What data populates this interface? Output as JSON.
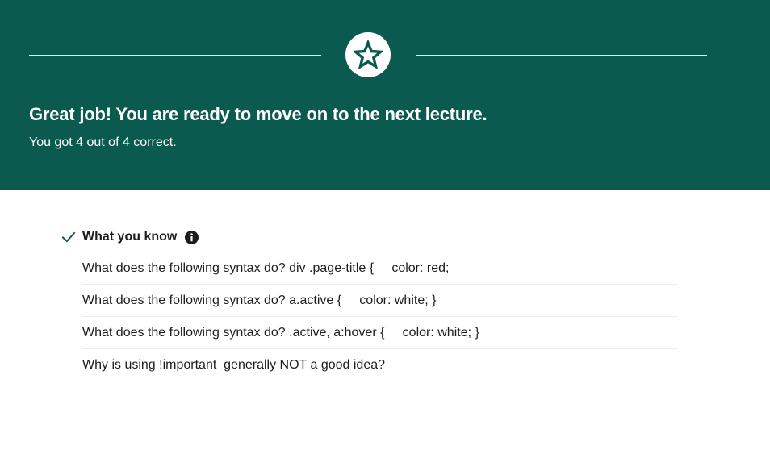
{
  "colors": {
    "banner_bg": "#0b5a4f",
    "accent": "#0b5a4f",
    "text": "#1c1d1f",
    "divider": "#e9ecee"
  },
  "banner": {
    "icon": "star-icon",
    "headline": "Great job! You are ready to move on to the next lecture.",
    "score_text": "You got 4 out of 4 correct."
  },
  "knowledge": {
    "status_icon": "checkmark-icon",
    "title": "What you know",
    "info_icon": "info-icon",
    "questions": [
      "What does the following syntax do? div .page-title {     color: red;",
      "What does the following syntax do? a.active {     color: white; }",
      "What does the following syntax do? .active, a:hover {     color: white; }",
      "Why is using !important  generally NOT a good idea?"
    ]
  }
}
